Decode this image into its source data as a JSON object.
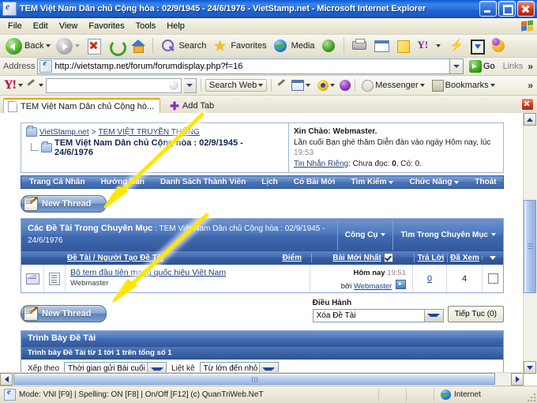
{
  "window": {
    "title": "TEM Việt Nam Dân chủ Cộng hòa : 02/9/1945 - 24/6/1976 - VietStamp.net - Microsoft Internet Explorer",
    "minimize_label": "Minimize",
    "maximize_label": "Restore",
    "close_label": "Close"
  },
  "menu": {
    "items": [
      {
        "label": "File"
      },
      {
        "label": "Edit"
      },
      {
        "label": "View"
      },
      {
        "label": "Favorites"
      },
      {
        "label": "Tools"
      },
      {
        "label": "Help"
      }
    ]
  },
  "toolbar": {
    "back_label": "Back",
    "forward_label": "Forward",
    "stop_label": "Stop",
    "refresh_label": "Refresh",
    "home_label": "Home",
    "search_label": "Search",
    "favorites_label": "Favorites",
    "media_label": "Media",
    "history_label": "History",
    "print_label": "Print",
    "edit_label": "Edit",
    "note_label": "Note",
    "yahoo_label": "Yahoo!",
    "messenger_label": "Messenger",
    "download_label": "Download",
    "smiley_label": "Smiley"
  },
  "address": {
    "label": "Address",
    "url": "http://vietstamp.net/forum/forumdisplay.php?f=16",
    "go_label": "Go",
    "links_label": "Links",
    "chevron": "»"
  },
  "yahoo_bar": {
    "logo": "Y!",
    "search_value": "",
    "search_web_label": "Search Web",
    "messenger_label": "Messenger",
    "bookmarks_label": "Bookmarks",
    "overflow": "»"
  },
  "tabs": {
    "items": [
      {
        "label": "TEM Việt Nam Dân chủ Cộng hò..."
      }
    ],
    "add_tab_label": "Add Tab",
    "close_label": "Close tab"
  },
  "forum": {
    "breadcrumb": {
      "root": "VietStamp.net",
      "separator": ">",
      "parent": "TEM VIỆT TRUYỀN THỐNG",
      "current": "TEM Việt Nam Dân chủ Cộng hòa : 02/9/1945 - 24/6/1976"
    },
    "welcome": {
      "greeting": "Xin Chào: Webmaster.",
      "lastvisit_prefix": "Lần cuối Bạn ghé thăm Diễn đàn vào ngày Hôm nay, lúc",
      "lastvisit_time": "19:53",
      "pm_link": "Tin Nhắn Riêng",
      "pm_text_prefix": ": Chưa đọc:",
      "pm_unread": "0",
      "pm_text_mid": ", Có:",
      "pm_total": "0."
    },
    "nav": [
      {
        "label": "Trang Cá Nhân",
        "caret": false
      },
      {
        "label": "Hướng Dẫn",
        "caret": false
      },
      {
        "label": "Danh Sách Thành Viên",
        "caret": false
      },
      {
        "label": "Lịch",
        "caret": false
      },
      {
        "label": "Có Bài Mới",
        "caret": false
      },
      {
        "label": "Tìm Kiếm",
        "caret": true
      },
      {
        "label": "Chức Năng",
        "caret": true
      },
      {
        "label": "Thoát",
        "caret": false
      }
    ],
    "new_thread_label": "New Thread",
    "table": {
      "heading_prefix": "Các Đề Tài Trong Chuyên Mục",
      "heading_title": ": TEM Việt Nam Dân chủ Cộng hòa : 02/9/1945 - 24/6/1976",
      "tools_label": "Công Cụ",
      "search_forum_label": "Tìm Trong Chuyên Mục",
      "columns": {
        "title": "Đề Tài / Người Tạo Đề Tài",
        "rating": "Điểm",
        "lastpost": "Bài Mới Nhất",
        "replies": "Trả Lời",
        "views": "Đã Xem"
      },
      "rows": [
        {
          "title": "Bộ tem đầu tiên mang quốc hiệu Việt Nam",
          "author": "Webmaster",
          "last_day": "Hôm nay",
          "last_time": "19:51",
          "last_by_prefix": "bởi",
          "last_by": "Webmaster",
          "replies": "0",
          "views": "4"
        }
      ]
    },
    "moderation": {
      "label": "Điều Hành",
      "select_value": "Xóa Đề Tài",
      "button_label": "Tiếp Tục (0)"
    },
    "display": {
      "heading": "Trình Bày Đề Tài",
      "subheading": "Trình bày Đề Tài từ 1 tới 1 trên tổng số 1",
      "sortby_label": "Xếp theo",
      "sortby_value": "Thời gian gửi Bài cuối",
      "listby_label": "Liệt kê",
      "listby_value": "Từ lớn đến nhỏ"
    }
  },
  "statusbar": {
    "message": "Mode: VNI [F9] | Spelling: ON [F8] | On/Off [F12] (c) QuanTriWeb.NeT",
    "zone": "Internet"
  }
}
